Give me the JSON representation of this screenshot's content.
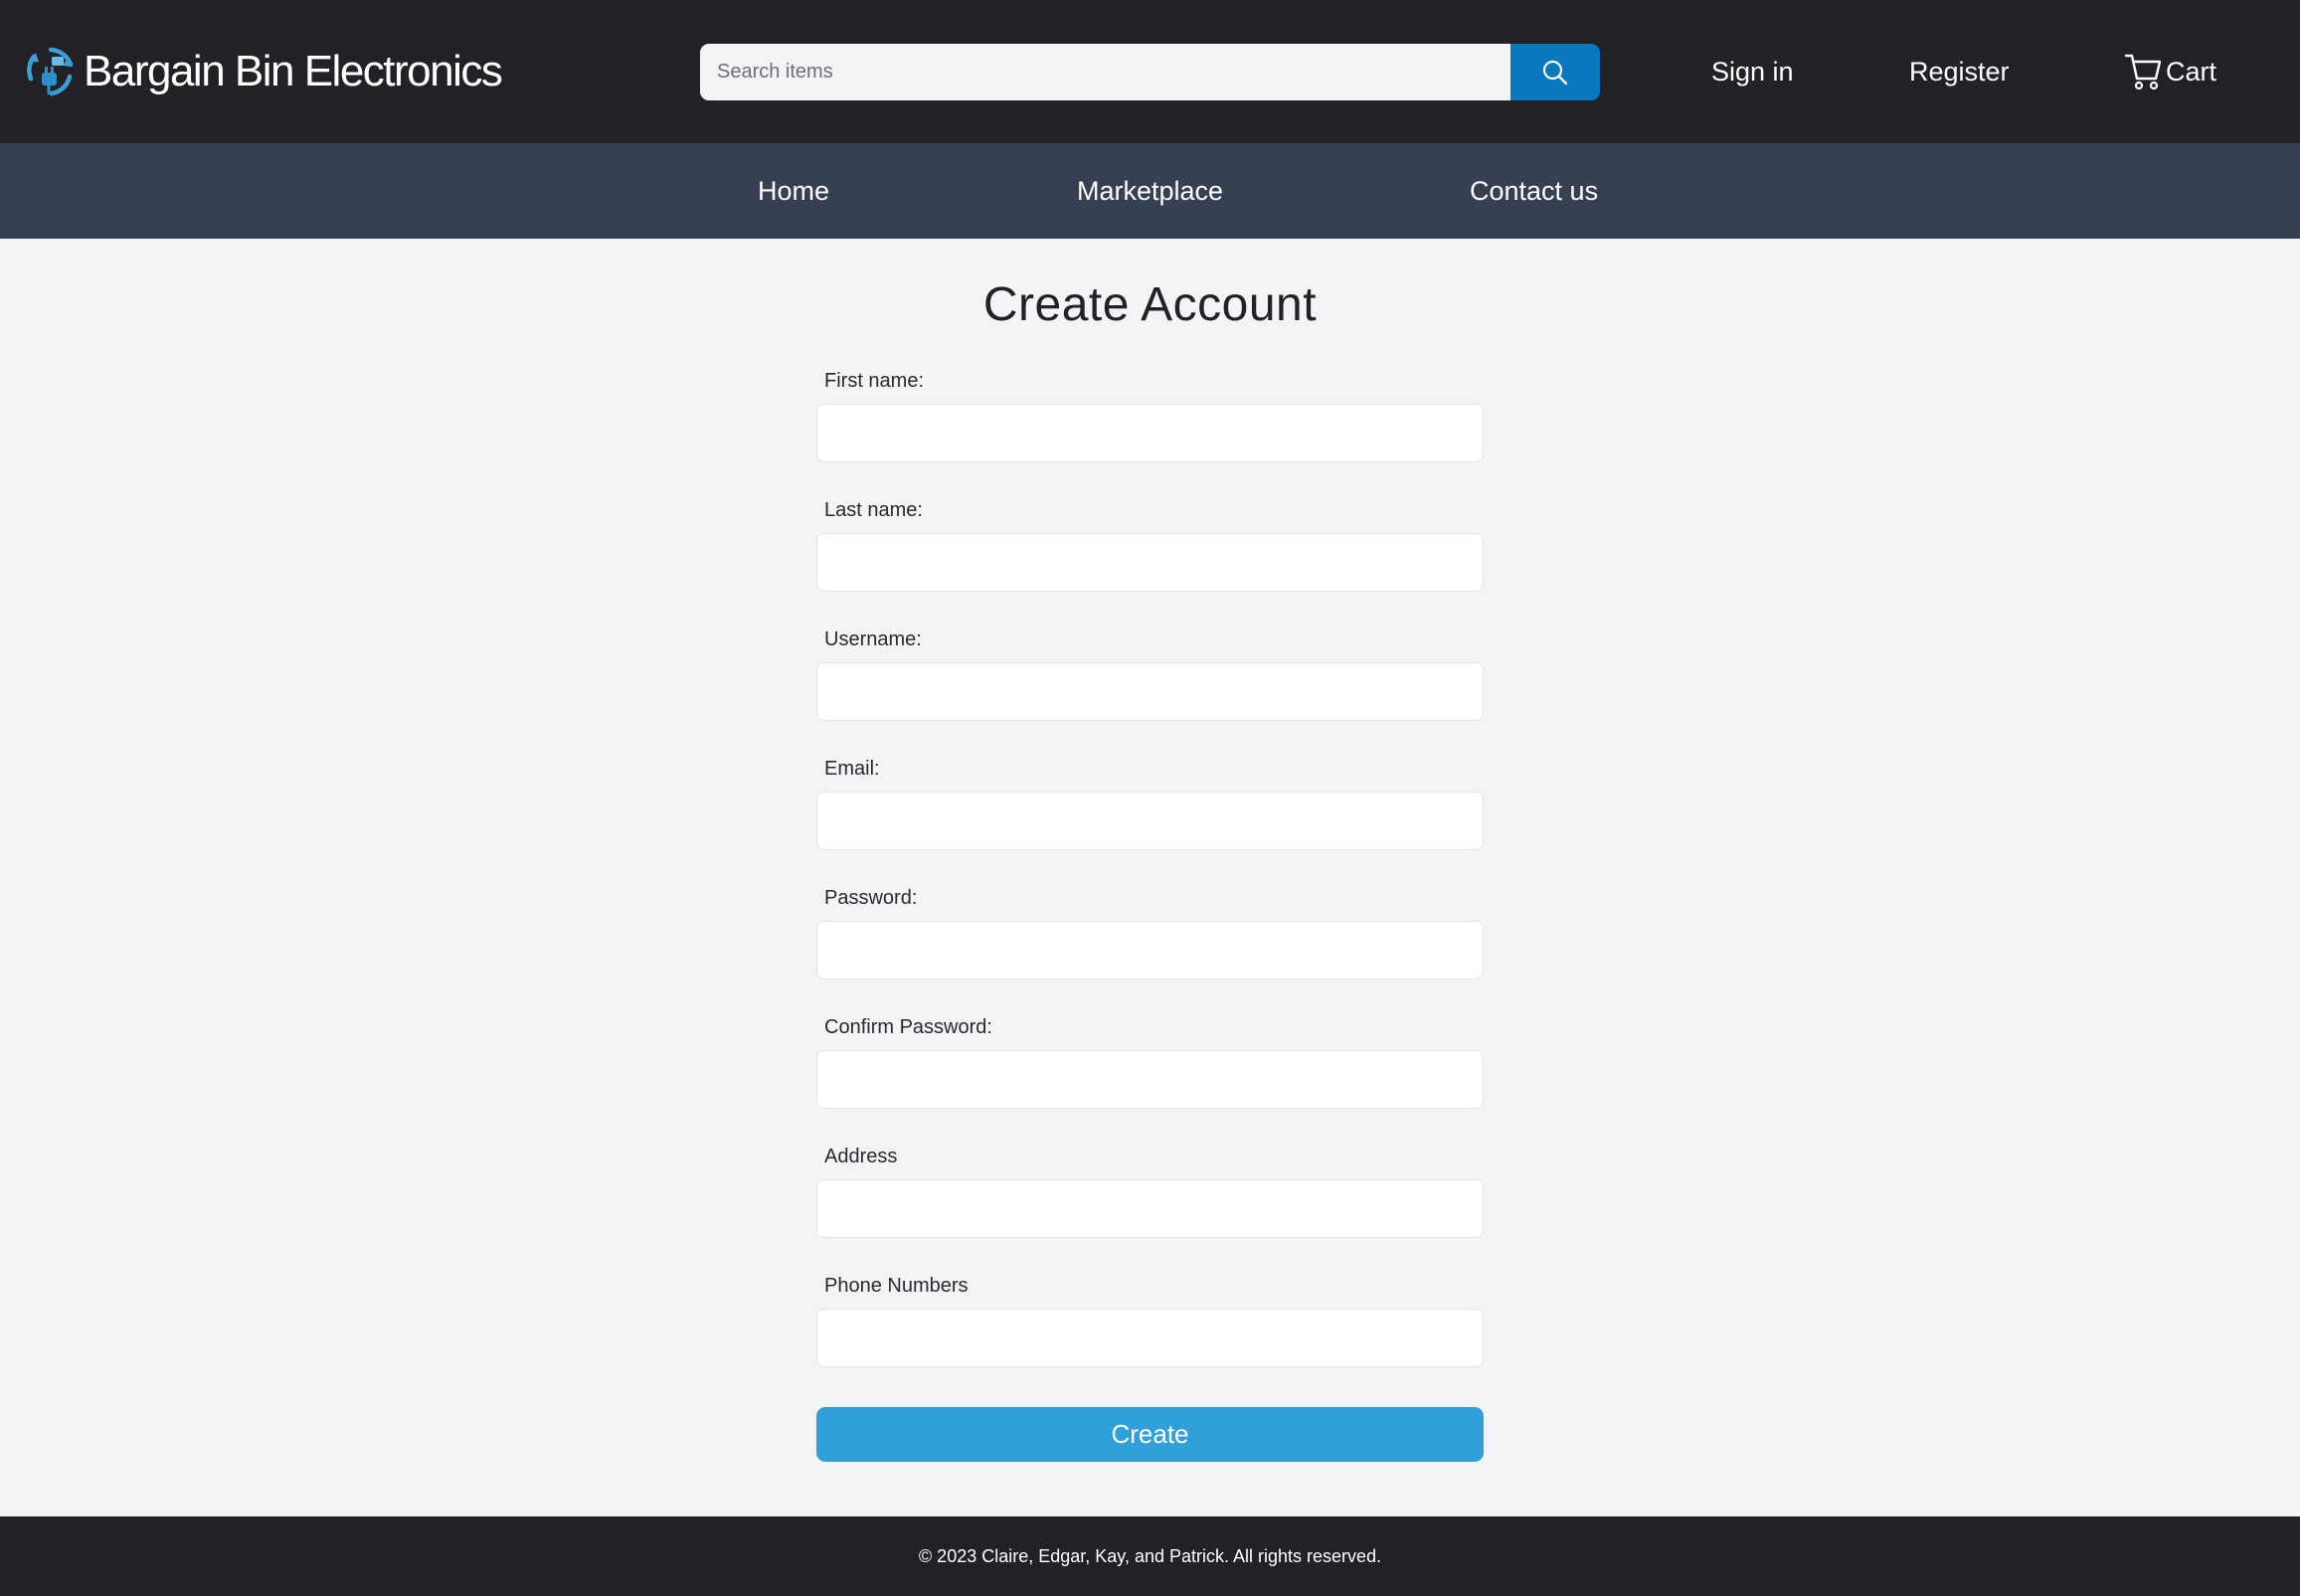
{
  "header": {
    "brand_name": "Bargain Bin Electronics",
    "logo_icon": "plug-recycle-logo-icon",
    "search": {
      "placeholder": "Search items",
      "value": "",
      "button_icon": "search-icon"
    },
    "sign_in_label": "Sign in",
    "register_label": "Register",
    "cart_label": "Cart",
    "cart_icon": "cart-icon"
  },
  "nav": {
    "home": "Home",
    "marketplace": "Marketplace",
    "contact": "Contact us"
  },
  "form": {
    "title": "Create Account",
    "fields": [
      {
        "label": "First name:",
        "value": ""
      },
      {
        "label": "Last name:",
        "value": ""
      },
      {
        "label": "Username:",
        "value": ""
      },
      {
        "label": "Email:",
        "value": ""
      },
      {
        "label": "Password:",
        "value": ""
      },
      {
        "label": "Confirm Password:",
        "value": ""
      },
      {
        "label": "Address",
        "value": ""
      },
      {
        "label": "Phone Numbers",
        "value": ""
      }
    ],
    "submit_label": "Create"
  },
  "footer": {
    "copyright": "© 2023 Claire, Edgar, Kay, and Patrick. All rights reserved."
  },
  "colors": {
    "header_bg": "#222226",
    "subnav_bg": "#374053",
    "page_bg": "#f4f4f6",
    "search_button": "#0a78bf",
    "create_button": "#31a0da"
  }
}
